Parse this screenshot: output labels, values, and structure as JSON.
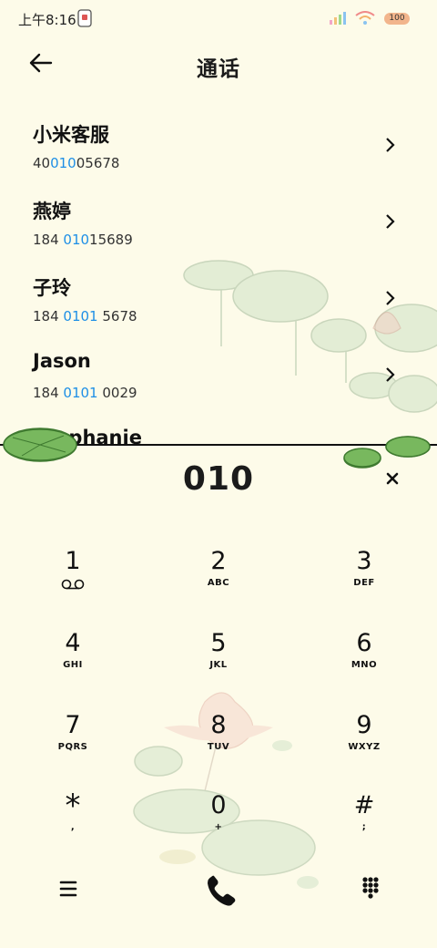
{
  "status": {
    "time": "上午8:16",
    "battery": "100"
  },
  "header": {
    "title": "通话"
  },
  "contacts": [
    {
      "name": "小米客服",
      "num_pre": "40",
      "num_hl": "010",
      "num_post": "05678"
    },
    {
      "name": "燕婷",
      "num_pre": "184 ",
      "num_hl": "010",
      "num_post": "15689"
    },
    {
      "name": "子玲",
      "num_pre": "184 ",
      "num_hl": "0101",
      "num_post": " 5678"
    },
    {
      "name": "Jason",
      "num_pre": "184 ",
      "num_hl": "0101",
      "num_post": " 0029"
    },
    {
      "name": "Stephanie"
    }
  ],
  "dialer": {
    "number": "010",
    "keys": [
      {
        "digit": "1",
        "letters": ""
      },
      {
        "digit": "2",
        "letters": "ABC"
      },
      {
        "digit": "3",
        "letters": "DEF"
      },
      {
        "digit": "4",
        "letters": "GHI"
      },
      {
        "digit": "5",
        "letters": "JKL"
      },
      {
        "digit": "6",
        "letters": "MNO"
      },
      {
        "digit": "7",
        "letters": "PQRS"
      },
      {
        "digit": "8",
        "letters": "TUV"
      },
      {
        "digit": "9",
        "letters": "WXYZ"
      },
      {
        "digit": "*",
        "letters": ","
      },
      {
        "digit": "0",
        "letters": "+"
      },
      {
        "digit": "#",
        "letters": ";"
      }
    ]
  },
  "icons": {
    "back": "arrow-left-icon",
    "chevron": "chevron-right-icon",
    "clear": "close-icon",
    "voicemail": "voicemail-icon",
    "menu": "menu-icon",
    "call": "phone-icon",
    "keypad": "dialpad-icon"
  },
  "colors": {
    "background": "#fdfbe9",
    "highlight": "#1e8fe6",
    "leaf": "#6fb65a"
  }
}
